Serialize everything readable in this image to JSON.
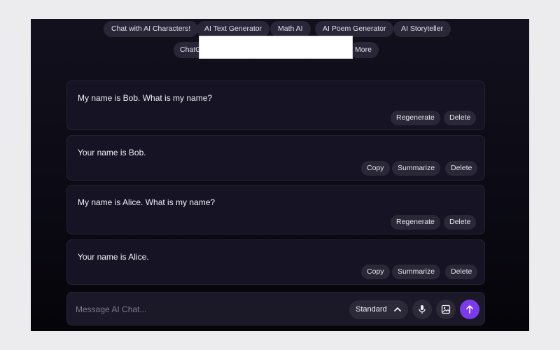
{
  "nav": {
    "row1": [
      "Chat with AI Characters!",
      "AI Text Generator",
      "Math AI",
      "AI Poem Generator",
      "AI Storyteller"
    ],
    "row2_partial": "ChatG",
    "more_label": "More"
  },
  "messages": [
    {
      "role": "user",
      "text": "My name is Bob. What is my name?",
      "actions": [
        "Regenerate",
        "Delete"
      ]
    },
    {
      "role": "assistant",
      "text": "Your name is Bob.",
      "actions": [
        "Copy",
        "Summarize",
        "Delete"
      ]
    },
    {
      "role": "user",
      "text": "My name is Alice. What is my name?",
      "actions": [
        "Regenerate",
        "Delete"
      ]
    },
    {
      "role": "assistant",
      "text": "Your name is Alice.",
      "actions": [
        "Copy",
        "Summarize",
        "Delete"
      ]
    }
  ],
  "composer": {
    "placeholder": "Message AI Chat...",
    "model": "Standard"
  },
  "icons": {
    "mic": "microphone-icon",
    "image": "image-icon",
    "send": "arrow-up-icon",
    "model_toggle": "chevron-up-icon"
  },
  "colors": {
    "accent": "#7c3aed",
    "background": "#0b0a14",
    "card": "#161424",
    "pill": "#292637"
  }
}
